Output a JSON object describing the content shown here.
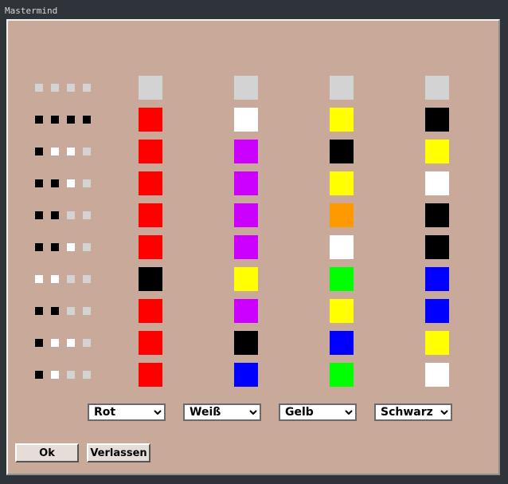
{
  "window": {
    "title": "Mastermind"
  },
  "colors": {
    "background": "#c9a99a",
    "empty": "#d3d3d3",
    "Rot": "#ff0000",
    "Weiß": "#ffffff",
    "Gelb": "#ffff00",
    "Schwarz": "#000000",
    "Lila": "#cc00ff",
    "Orange": "#ff9900",
    "Grün": "#00ff00",
    "Blau": "#0000ff"
  },
  "rows": [
    {
      "pegs": [
        "empty",
        "empty",
        "empty",
        "empty"
      ],
      "feedback": [
        "empty",
        "empty",
        "empty",
        "empty"
      ]
    },
    {
      "pegs": [
        "Rot",
        "Weiß",
        "Gelb",
        "Schwarz"
      ],
      "feedback": [
        "Schwarz",
        "Schwarz",
        "Schwarz",
        "Schwarz"
      ]
    },
    {
      "pegs": [
        "Rot",
        "Lila",
        "Schwarz",
        "Gelb"
      ],
      "feedback": [
        "Schwarz",
        "Weiß",
        "Weiß",
        "empty"
      ]
    },
    {
      "pegs": [
        "Rot",
        "Lila",
        "Gelb",
        "Weiß"
      ],
      "feedback": [
        "Schwarz",
        "Schwarz",
        "Weiß",
        "empty"
      ]
    },
    {
      "pegs": [
        "Rot",
        "Lila",
        "Orange",
        "Schwarz"
      ],
      "feedback": [
        "Schwarz",
        "Schwarz",
        "empty",
        "empty"
      ]
    },
    {
      "pegs": [
        "Rot",
        "Lila",
        "Weiß",
        "Schwarz"
      ],
      "feedback": [
        "Schwarz",
        "Schwarz",
        "Weiß",
        "empty"
      ]
    },
    {
      "pegs": [
        "Schwarz",
        "Gelb",
        "Grün",
        "Blau"
      ],
      "feedback": [
        "Weiß",
        "Weiß",
        "empty",
        "empty"
      ]
    },
    {
      "pegs": [
        "Rot",
        "Lila",
        "Gelb",
        "Blau"
      ],
      "feedback": [
        "Schwarz",
        "Schwarz",
        "empty",
        "empty"
      ]
    },
    {
      "pegs": [
        "Rot",
        "Schwarz",
        "Blau",
        "Gelb"
      ],
      "feedback": [
        "Schwarz",
        "Weiß",
        "Weiß",
        "empty"
      ]
    },
    {
      "pegs": [
        "Rot",
        "Blau",
        "Grün",
        "Weiß"
      ],
      "feedback": [
        "Schwarz",
        "Weiß",
        "empty",
        "empty"
      ]
    }
  ],
  "selectors": [
    {
      "selected": "Rot"
    },
    {
      "selected": "Weiß"
    },
    {
      "selected": "Gelb"
    },
    {
      "selected": "Schwarz"
    }
  ],
  "buttons": {
    "ok": "Ok",
    "quit": "Verlassen"
  }
}
